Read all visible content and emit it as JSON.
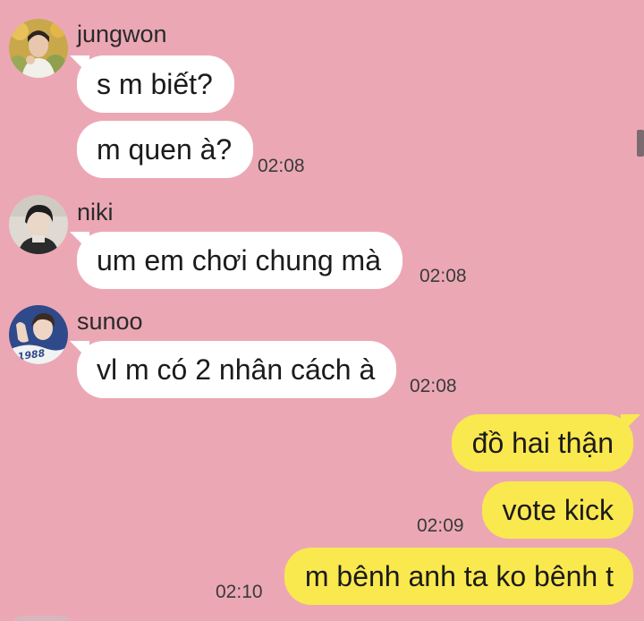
{
  "colors": {
    "background": "#eba8b4",
    "incoming_bubble": "#ffffff",
    "outgoing_bubble": "#fae84f",
    "text": "#1b1b1b"
  },
  "icons": {
    "jungwon_avatar": "jungwon-avatar",
    "niki_avatar": "niki-avatar",
    "sunoo_avatar": "sunoo-avatar"
  },
  "jungwon_avatar_text": "",
  "sunoo_avatar_text": "1988",
  "messages": {
    "jungwon": {
      "name": "jungwon",
      "m1": "s m biết?",
      "m2": "m quen à?",
      "time": "02:08"
    },
    "niki": {
      "name": "niki",
      "m1": "um em chơi chung mà",
      "time": "02:08"
    },
    "sunoo": {
      "name": "sunoo",
      "m1": "vl m có 2 nhân cách à",
      "time": "02:08"
    },
    "me": {
      "m1": "đồ hai thận",
      "m2": "vote kick",
      "m2_time": "02:09",
      "m3": "m bênh anh ta ko bênh t",
      "m3_time": "02:10"
    }
  }
}
